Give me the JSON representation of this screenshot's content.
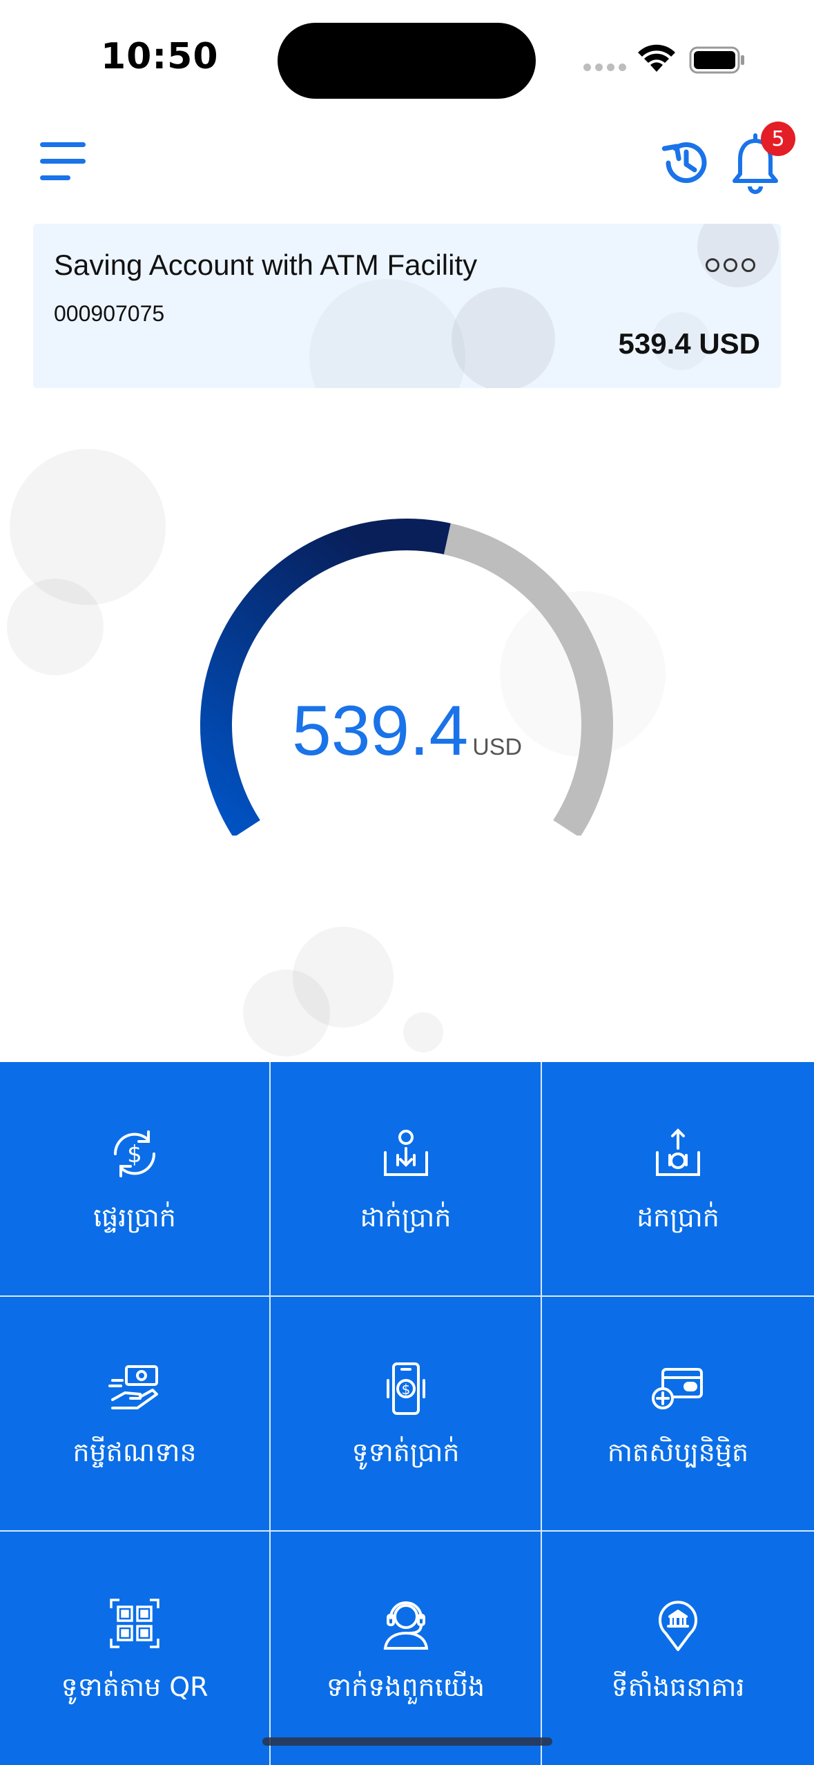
{
  "status_bar": {
    "time": "10:50"
  },
  "header": {
    "notification_count": "5"
  },
  "account": {
    "name": "Saving Account with ATM Facility",
    "number": "000907075",
    "balance": "539.4 USD"
  },
  "gauge": {
    "value": "539.4",
    "currency": "USD",
    "fill_fraction": 0.55
  },
  "colors": {
    "primary": "#0b6ee8",
    "accent": "#1a73e8",
    "navy": "#0a1f5c",
    "track": "#bdbdbd",
    "badge": "#e41e26"
  },
  "actions": [
    {
      "label": "ផ្ទេរប្រាក់",
      "icon": "transfer-icon"
    },
    {
      "label": "ដាក់ប្រាក់",
      "icon": "deposit-icon"
    },
    {
      "label": "ដកប្រាក់",
      "icon": "withdraw-icon"
    },
    {
      "label": "កម្ចីឥណទាន",
      "icon": "loan-icon"
    },
    {
      "label": "ទូទាត់ប្រាក់",
      "icon": "payment-icon"
    },
    {
      "label": "កាតសិប្បនិម្មិត",
      "icon": "virtual-card-icon"
    },
    {
      "label": "ទូទាត់តាម QR",
      "icon": "qr-code-icon"
    },
    {
      "label": "ទាក់ទងពួកយើង",
      "icon": "support-agent-icon"
    },
    {
      "label": "ទីតាំងធនាគារ",
      "icon": "bank-location-icon"
    }
  ]
}
